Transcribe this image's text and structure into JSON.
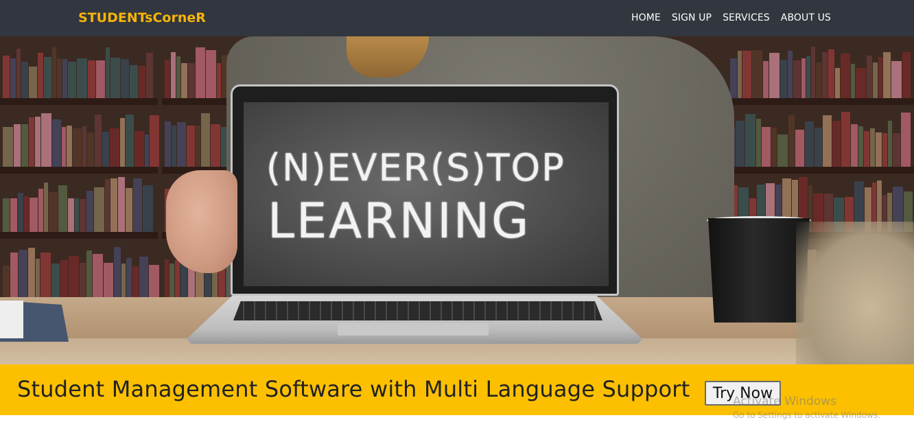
{
  "navbar": {
    "brand": "STUDENTsCorneR",
    "links": [
      "HOME",
      "SIGN UP",
      "SERVICES",
      "ABOUT US"
    ]
  },
  "hero": {
    "chalk_line_1": "(N)EVER(S)TOP",
    "chalk_line_2": "LEARNING"
  },
  "banner": {
    "text": "Student Management Software with Multi Language Support",
    "button_label": "Try Now"
  },
  "watermark": {
    "title": "Activate Windows",
    "subtitle": "Go to Settings to activate Windows."
  },
  "colors": {
    "navbar_bg": "#32363e",
    "brand": "#f6b40b",
    "banner_bg": "#fcc001"
  }
}
